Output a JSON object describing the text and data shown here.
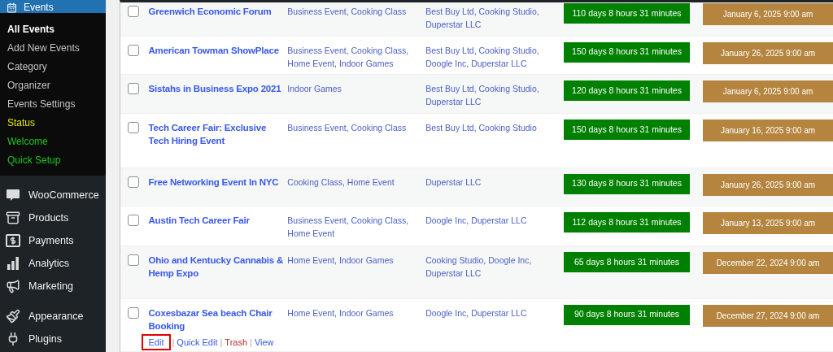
{
  "sidebar": {
    "current": {
      "label": "Events",
      "selected": true
    },
    "submenu": [
      {
        "label": "All Events",
        "selected": true,
        "color": "#ffffff"
      },
      {
        "label": "Add New Events",
        "selected": false,
        "color": "#c3c4c7"
      },
      {
        "label": "Category",
        "selected": false,
        "color": "#c3c4c7"
      },
      {
        "label": "Organizer",
        "selected": false,
        "color": "#c3c4c7"
      },
      {
        "label": "Events Settings",
        "selected": false,
        "color": "#c3c4c7"
      },
      {
        "label": "Status",
        "selected": false,
        "color": "#e6e600"
      },
      {
        "label": "Welcome",
        "selected": false,
        "color": "#22c322"
      },
      {
        "label": "Quick Setup",
        "selected": false,
        "color": "#22c322"
      }
    ],
    "menu_groups": [
      {
        "items": [
          {
            "label": "WooCommerce",
            "kind": "woo",
            "selected": false
          },
          {
            "label": "Products",
            "kind": "box",
            "selected": false
          },
          {
            "label": "Payments",
            "kind": "dollar",
            "selected": false
          },
          {
            "label": "Analytics",
            "kind": "bars",
            "selected": false
          },
          {
            "label": "Marketing",
            "kind": "megaphone",
            "selected": false
          }
        ]
      },
      {
        "items": [
          {
            "label": "Appearance",
            "kind": "brush",
            "selected": false
          },
          {
            "label": "Plugins",
            "kind": "plug",
            "selected": false
          }
        ]
      }
    ]
  },
  "table": {
    "rows": [
      {
        "title": "Greenwich Economic Forum",
        "categories": "Business Event, Cooking Class",
        "organizers": "Best Buy Ltd, Cooking Studio, Duperstar LLC",
        "countdown": "110 days 8 hours 31 minutes",
        "date": "January 6, 2025 9:00 am",
        "checked": false
      },
      {
        "title": "American Towman ShowPlace",
        "categories": "Business Event, Cooking Class, Home Event, Indoor Games",
        "organizers": "Best Buy Ltd, Cooking Studio, Doogle Inc, Duperstar LLC",
        "countdown": "150 days 8 hours 31 minutes",
        "date": "January 26, 2025 9:00 am",
        "checked": false
      },
      {
        "title": "Sistahs in Business Expo 2021",
        "categories": "Indoor Games",
        "organizers": "Best Buy Ltd, Cooking Studio, Duperstar LLC",
        "countdown": "120 days 8 hours 31 minutes",
        "date": "January 6, 2025 9:00 am",
        "checked": false
      },
      {
        "title": "Tech Career Fair: Exclusive Tech Hiring Event",
        "categories": "Business Event, Cooking Class",
        "organizers": "Best Buy Ltd, Cooking Studio",
        "countdown": "150 days 8 hours 31 minutes",
        "date": "January 16, 2025 9:00 am",
        "checked": false
      },
      {
        "title": "Free Networking Event In NYC",
        "categories": "Cooking Class, Home Event",
        "organizers": "Duperstar LLC",
        "countdown": "130 days 8 hours 31 minutes",
        "date": "January 26, 2025 9:00 am",
        "checked": false
      },
      {
        "title": "Austin Tech Career Fair",
        "categories": "Business Event, Cooking Class, Home Event",
        "organizers": "Doogle Inc, Duperstar LLC",
        "countdown": "112 days 8 hours 31 minutes",
        "date": "January 13, 2025 9:00 am",
        "checked": false
      },
      {
        "title": "Ohio and Kentucky Cannabis & Hemp Expo",
        "categories": "Home Event, Indoor Games",
        "organizers": "Cooking Studio, Doogle Inc, Duperstar LLC",
        "countdown": "65 days 8 hours 31 minutes",
        "date": "December 22, 2024 9:00 am",
        "checked": false
      },
      {
        "title": "Coxesbazar Sea beach Chair Booking",
        "categories": "Home Event, Indoor Games",
        "organizers": "Doogle Inc, Duperstar LLC",
        "countdown": "90 days 8 hours 31 minutes",
        "date": "December 27, 2024 9:00 am",
        "checked": false,
        "actions": [
          {
            "label": "Edit",
            "kind": "link",
            "outlined": true
          },
          {
            "label": "Quick Edit",
            "kind": "link",
            "outlined": false
          },
          {
            "label": "Trash",
            "kind": "danger",
            "outlined": false
          },
          {
            "label": "View",
            "kind": "link",
            "outlined": false
          }
        ],
        "separator": "|"
      }
    ]
  }
}
